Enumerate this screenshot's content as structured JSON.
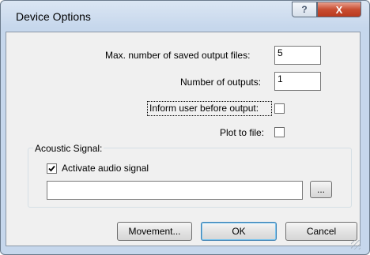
{
  "window": {
    "title": "Device Options",
    "help_symbol": "?",
    "close_symbol": "X"
  },
  "options": {
    "max_saved_label": "Max. number of saved output files:",
    "max_saved_value": "5",
    "num_outputs_label": "Number of outputs:",
    "num_outputs_value": "1",
    "inform_label": "Inform user before output:",
    "inform_checked": false,
    "plot_label": "Plot to file:",
    "plot_checked": false
  },
  "acoustic": {
    "group_label": "Acoustic Signal:",
    "activate_label": "Activate audio signal",
    "activate_checked": true,
    "file_value": "",
    "browse_label": "..."
  },
  "buttons": {
    "movement": "Movement...",
    "ok": "OK",
    "cancel": "Cancel"
  }
}
